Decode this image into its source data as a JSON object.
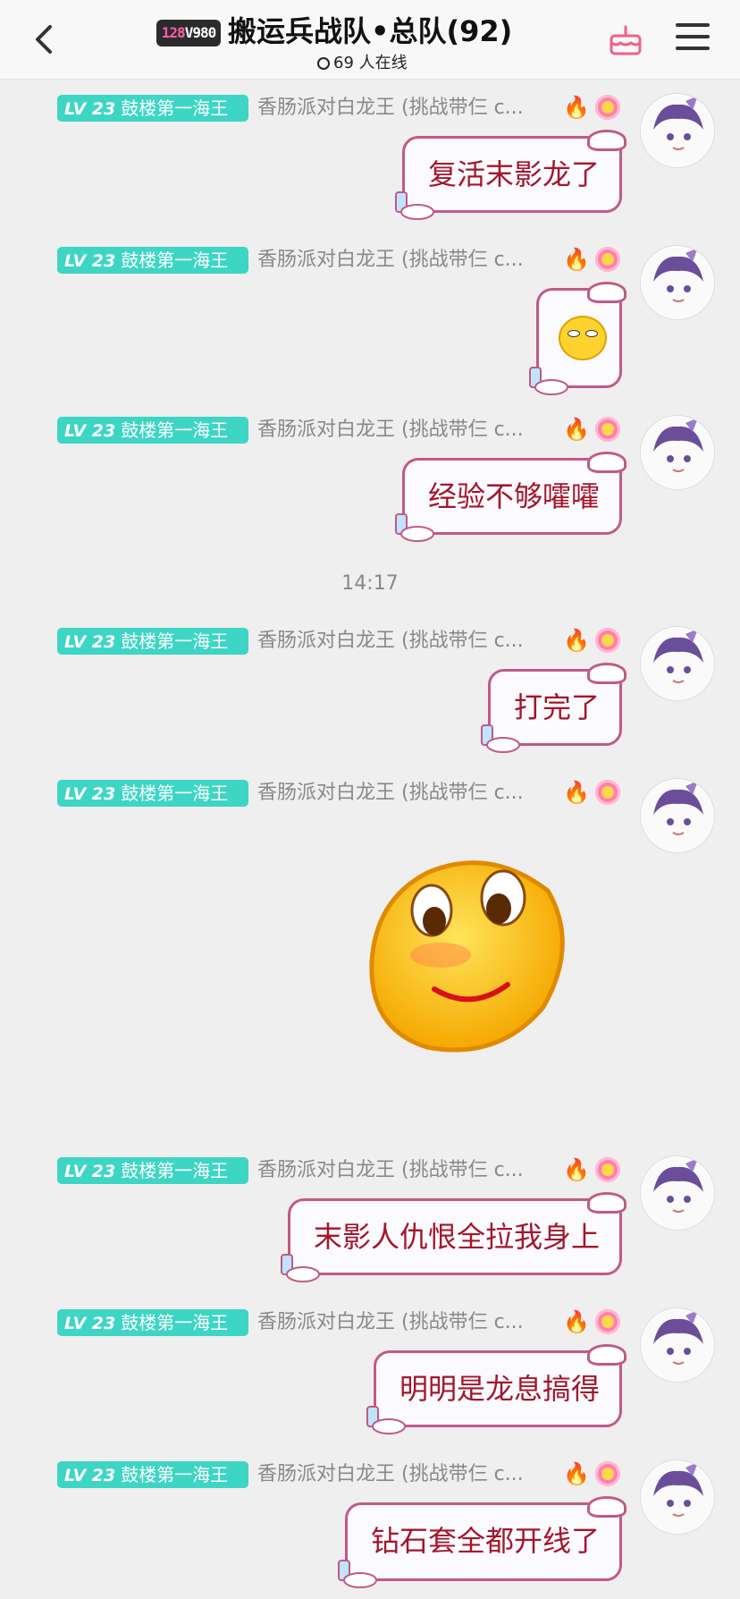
{
  "header": {
    "group_tag_left": "128",
    "group_tag_right": "V980",
    "title": "搬运兵战队•总队(92)",
    "online": "69 人在线"
  },
  "sender": {
    "level": "LV 23",
    "level_name": "鼓楼第一海王",
    "nickname": "香肠派对白龙王 (挑战带仨 c..."
  },
  "messages": [
    {
      "text": "复活末影龙了"
    },
    {
      "text": ""
    },
    {
      "text": "经验不够嚯嚯"
    },
    {
      "text": "打完了"
    },
    {
      "text": ""
    },
    {
      "text": "末影人仇恨全拉我身上"
    },
    {
      "text": "明明是龙息搞得"
    },
    {
      "text": "钻石套全都开线了"
    }
  ],
  "timestamp": "14:17",
  "colors": {
    "level_badge": "#3dd5c4",
    "bubble_border": "#c05a86",
    "bubble_text": "#a3162a"
  }
}
